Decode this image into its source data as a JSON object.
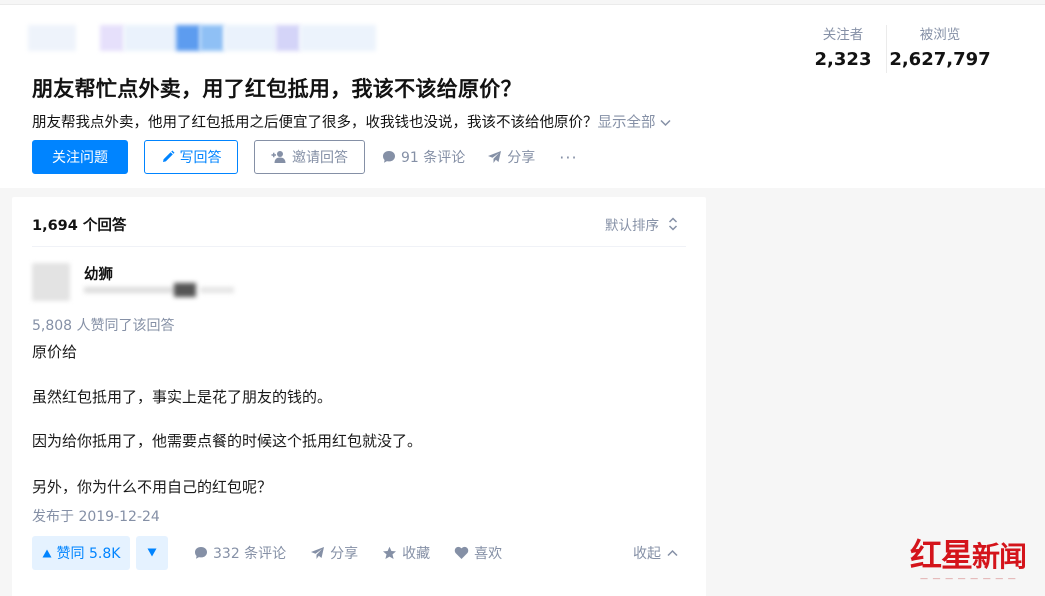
{
  "question": {
    "title": "朋友帮忙点外卖，用了红包抵用，我该不该给原价？",
    "detail": "朋友帮我点外卖，他用了红包抵用之后便宜了很多，收我钱也没说，我该不该给他原价？",
    "show_all": "显示全部",
    "follow_button": "关注问题",
    "write_answer_button": "写回答",
    "invite_button": "邀请回答",
    "comments": "91 条评论",
    "share": "分享",
    "more": "···"
  },
  "stats": {
    "followers_label": "关注者",
    "followers_value": "2,323",
    "views_label": "被浏览",
    "views_value": "2,627,797"
  },
  "answers": {
    "count": "1,694 个回答",
    "sort_label": "默认排序"
  },
  "answer": {
    "author_name": "幼狮",
    "voters": "5,808 人赞同了该回答",
    "paragraphs": [
      "原价给",
      "虽然红包抵用了，事实上是花了朋友的钱的。",
      "因为给你抵用了，他需要点餐的时候这个抵用红包就没了。",
      "另外，你为什么不用自己的红包呢？"
    ],
    "published": "发布于 2019-12-24",
    "upvote": "赞同 5.8K",
    "comments": "332 条评论",
    "share": "分享",
    "favorite": "收藏",
    "like": "喜欢",
    "collapse": "收起"
  },
  "watermark": {
    "text_a": "红星",
    "text_b": "新闻"
  },
  "colors": {
    "accent": "#0084ff",
    "muted": "#8590a6",
    "watermark_red": "#d4141b"
  }
}
